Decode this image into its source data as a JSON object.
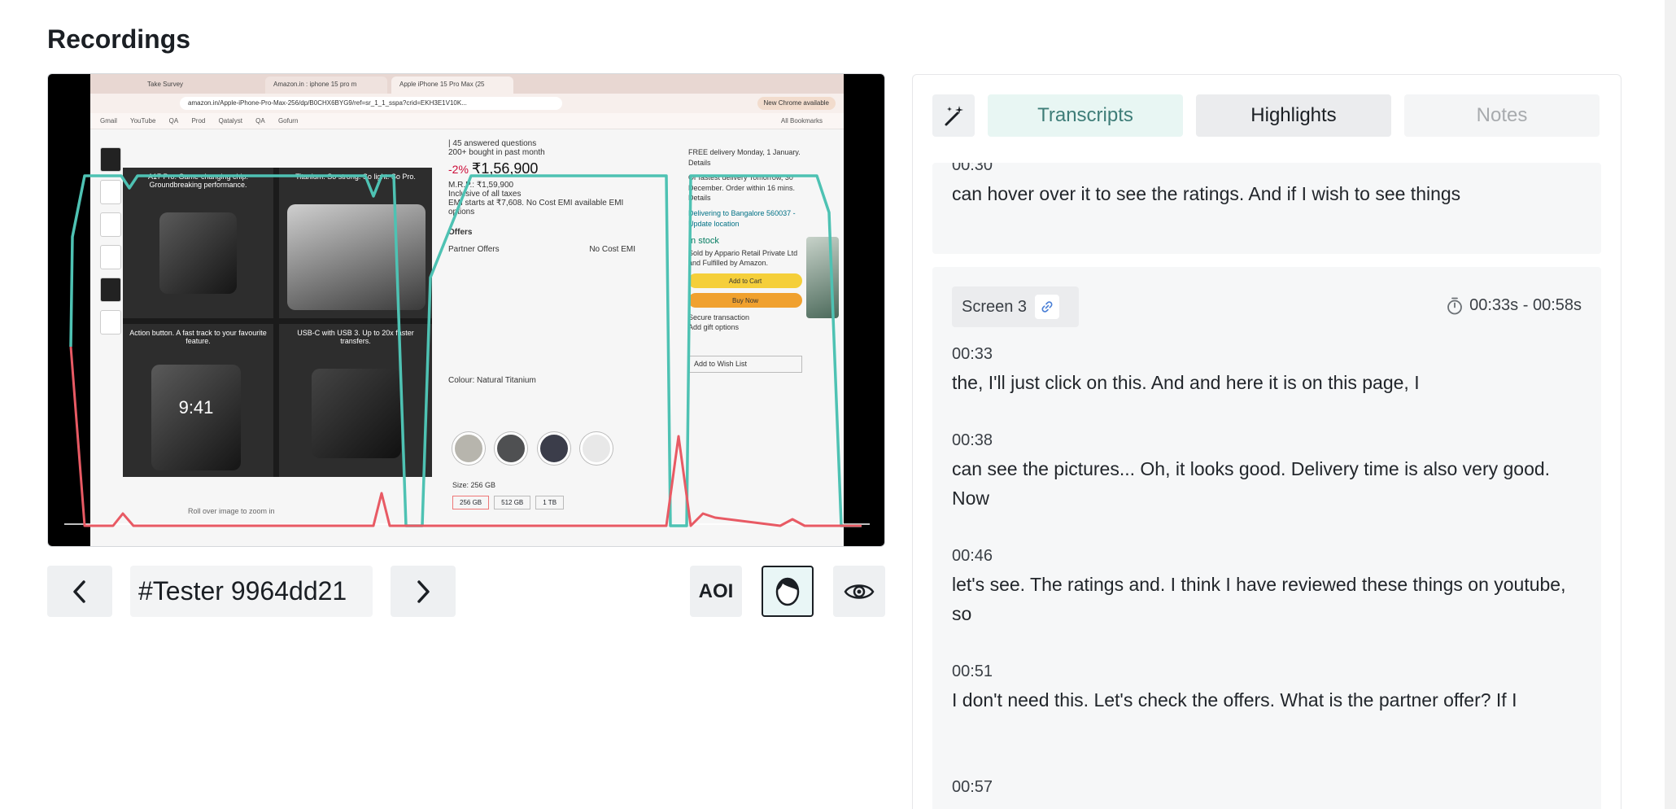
{
  "page": {
    "title": "Recordings"
  },
  "video": {
    "browser_tabs": [
      "Take Survey",
      "Amazon.in : iphone 15 pro m",
      "Apple iPhone 15 Pro Max (25"
    ],
    "url": "amazon.in/Apple-iPhone-Pro-Max-256/dp/B0CHX6BYG9/ref=sr_1_1_sspa?crid=EKH3E1V10K...",
    "chrome_badge": "New Chrome available",
    "bookmarks": [
      "Gmail",
      "YouTube",
      "QA",
      "Prod",
      "Qatalyst",
      "QA",
      "Gofurn",
      "All Bookmarks"
    ],
    "gallery": {
      "cell1": "A17 Pro. Game-changing chip. Groundbreaking performance.",
      "cell2": "Titanium. So strong. So light. So Pro.",
      "cell3": "Action button. A fast track to your favourite feature.",
      "cell4": "USB-C with USB 3. Up to 20x faster transfers.",
      "phone_time": "9:41",
      "zoom_hint": "Roll over image to zoom in"
    },
    "product": {
      "answered": "| 45 answered questions",
      "bought": "200+ bought in past month",
      "discount": "-2%",
      "price": "₹1,56,900",
      "mrp": "M.R.P.: ₹1,59,900",
      "taxes": "Inclusive of all taxes",
      "emi": "EMI starts at ₹7,608. No Cost EMI available EMI options",
      "offers": "Offers",
      "partner": "Partner Offers",
      "nocost": "No Cost EMI",
      "colour": "Colour: Natural Titanium",
      "size": "Size: 256 GB",
      "sizes": [
        "256 GB",
        "512 GB",
        "1 TB"
      ]
    },
    "buybox": {
      "delivery": "FREE delivery Monday, 1 January. Details",
      "fastest": "Or fastest delivery Tomorrow, 30 December. Order within 16 mins. Details",
      "location": "Delivering to Bangalore 560037 - Update location",
      "stock": "In stock",
      "sold": "Sold by Appario Retail Private Ltd and Fulfilled by Amazon.",
      "add": "Add to Cart",
      "buy": "Buy Now",
      "secure": "Secure transaction",
      "gift": "Add gift options",
      "wish": "Add to Wish List"
    }
  },
  "controls": {
    "tester_id": "#Tester 9964dd21",
    "aoi_label": "AOI"
  },
  "tabs": {
    "transcripts": "Transcripts",
    "highlights": "Highlights",
    "notes": "Notes"
  },
  "transcript": {
    "first_segment": {
      "timestamp": "00:30",
      "text": "can hover over it to see the ratings. And if I wish to see things"
    },
    "screen_segment": {
      "screen_label": "Screen 3",
      "time_range": "00:33s - 00:58s",
      "entries": [
        {
          "timestamp": "00:33",
          "text": "the, I'll just click on this. And and here it is on this page, I"
        },
        {
          "timestamp": "00:38",
          "text": "can see the pictures... Oh, it looks good. Delivery time is also very good. Now"
        },
        {
          "timestamp": "00:46",
          "text": "let's see. The ratings and. I think I have reviewed these things on youtube, so"
        },
        {
          "timestamp": "00:51",
          "text": "I don't need this. Let's check the offers. What is the partner offer? If I"
        },
        {
          "timestamp": "00:57",
          "text": ""
        }
      ]
    }
  },
  "colors": {
    "accent_teal": "#4ec2b3",
    "accent_red": "#e85a64",
    "tab_active_bg": "#e8f6f3"
  }
}
